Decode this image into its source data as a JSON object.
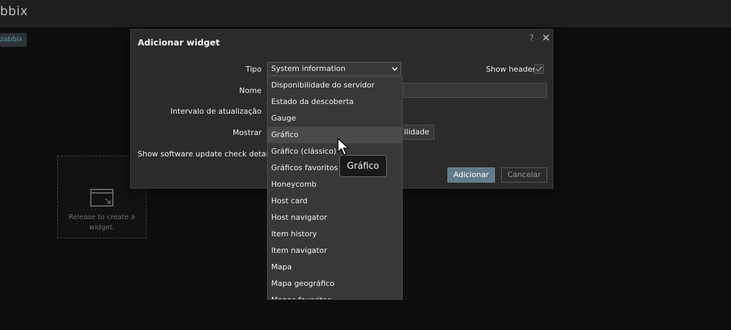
{
  "header": {
    "title": "bbix"
  },
  "host_tag": "zabbix",
  "placeholder": {
    "line1": "Release to create a",
    "line2": "widget."
  },
  "dialog": {
    "title": "Adicionar widget",
    "help": "?",
    "close": "✕",
    "fields": {
      "tipo_label": "Tipo",
      "tipo_value": "System information",
      "show_header_label": "Show header",
      "show_header_checked": true,
      "nome_label": "Nome",
      "intervalo_label": "Intervalo de atualização",
      "mostrar_label": "Mostrar",
      "mostrar_partial_option": "ilidade",
      "software_label": "Show software update check details"
    },
    "buttons": {
      "add": "Adicionar",
      "cancel": "Cancelar"
    }
  },
  "dropdown": {
    "hovered_index": 3,
    "options": [
      "Disponibilidade do servidor",
      "Estado da descoberta",
      "Gauge",
      "Gráfico",
      "Gráfico (clássico)",
      "Gráficos favoritos",
      "Honeycomb",
      "Host card",
      "Host navigator",
      "Item history",
      "Item navigator",
      "Mapa",
      "Mapa geográfico",
      "Mapas favoritos"
    ]
  },
  "tooltip": "Gráfico",
  "colors": {
    "background": "#0e0e0e",
    "dialog": "#2b2b2b",
    "primary_button": "#627b8a",
    "host_tag_text": "#5c99a8"
  }
}
